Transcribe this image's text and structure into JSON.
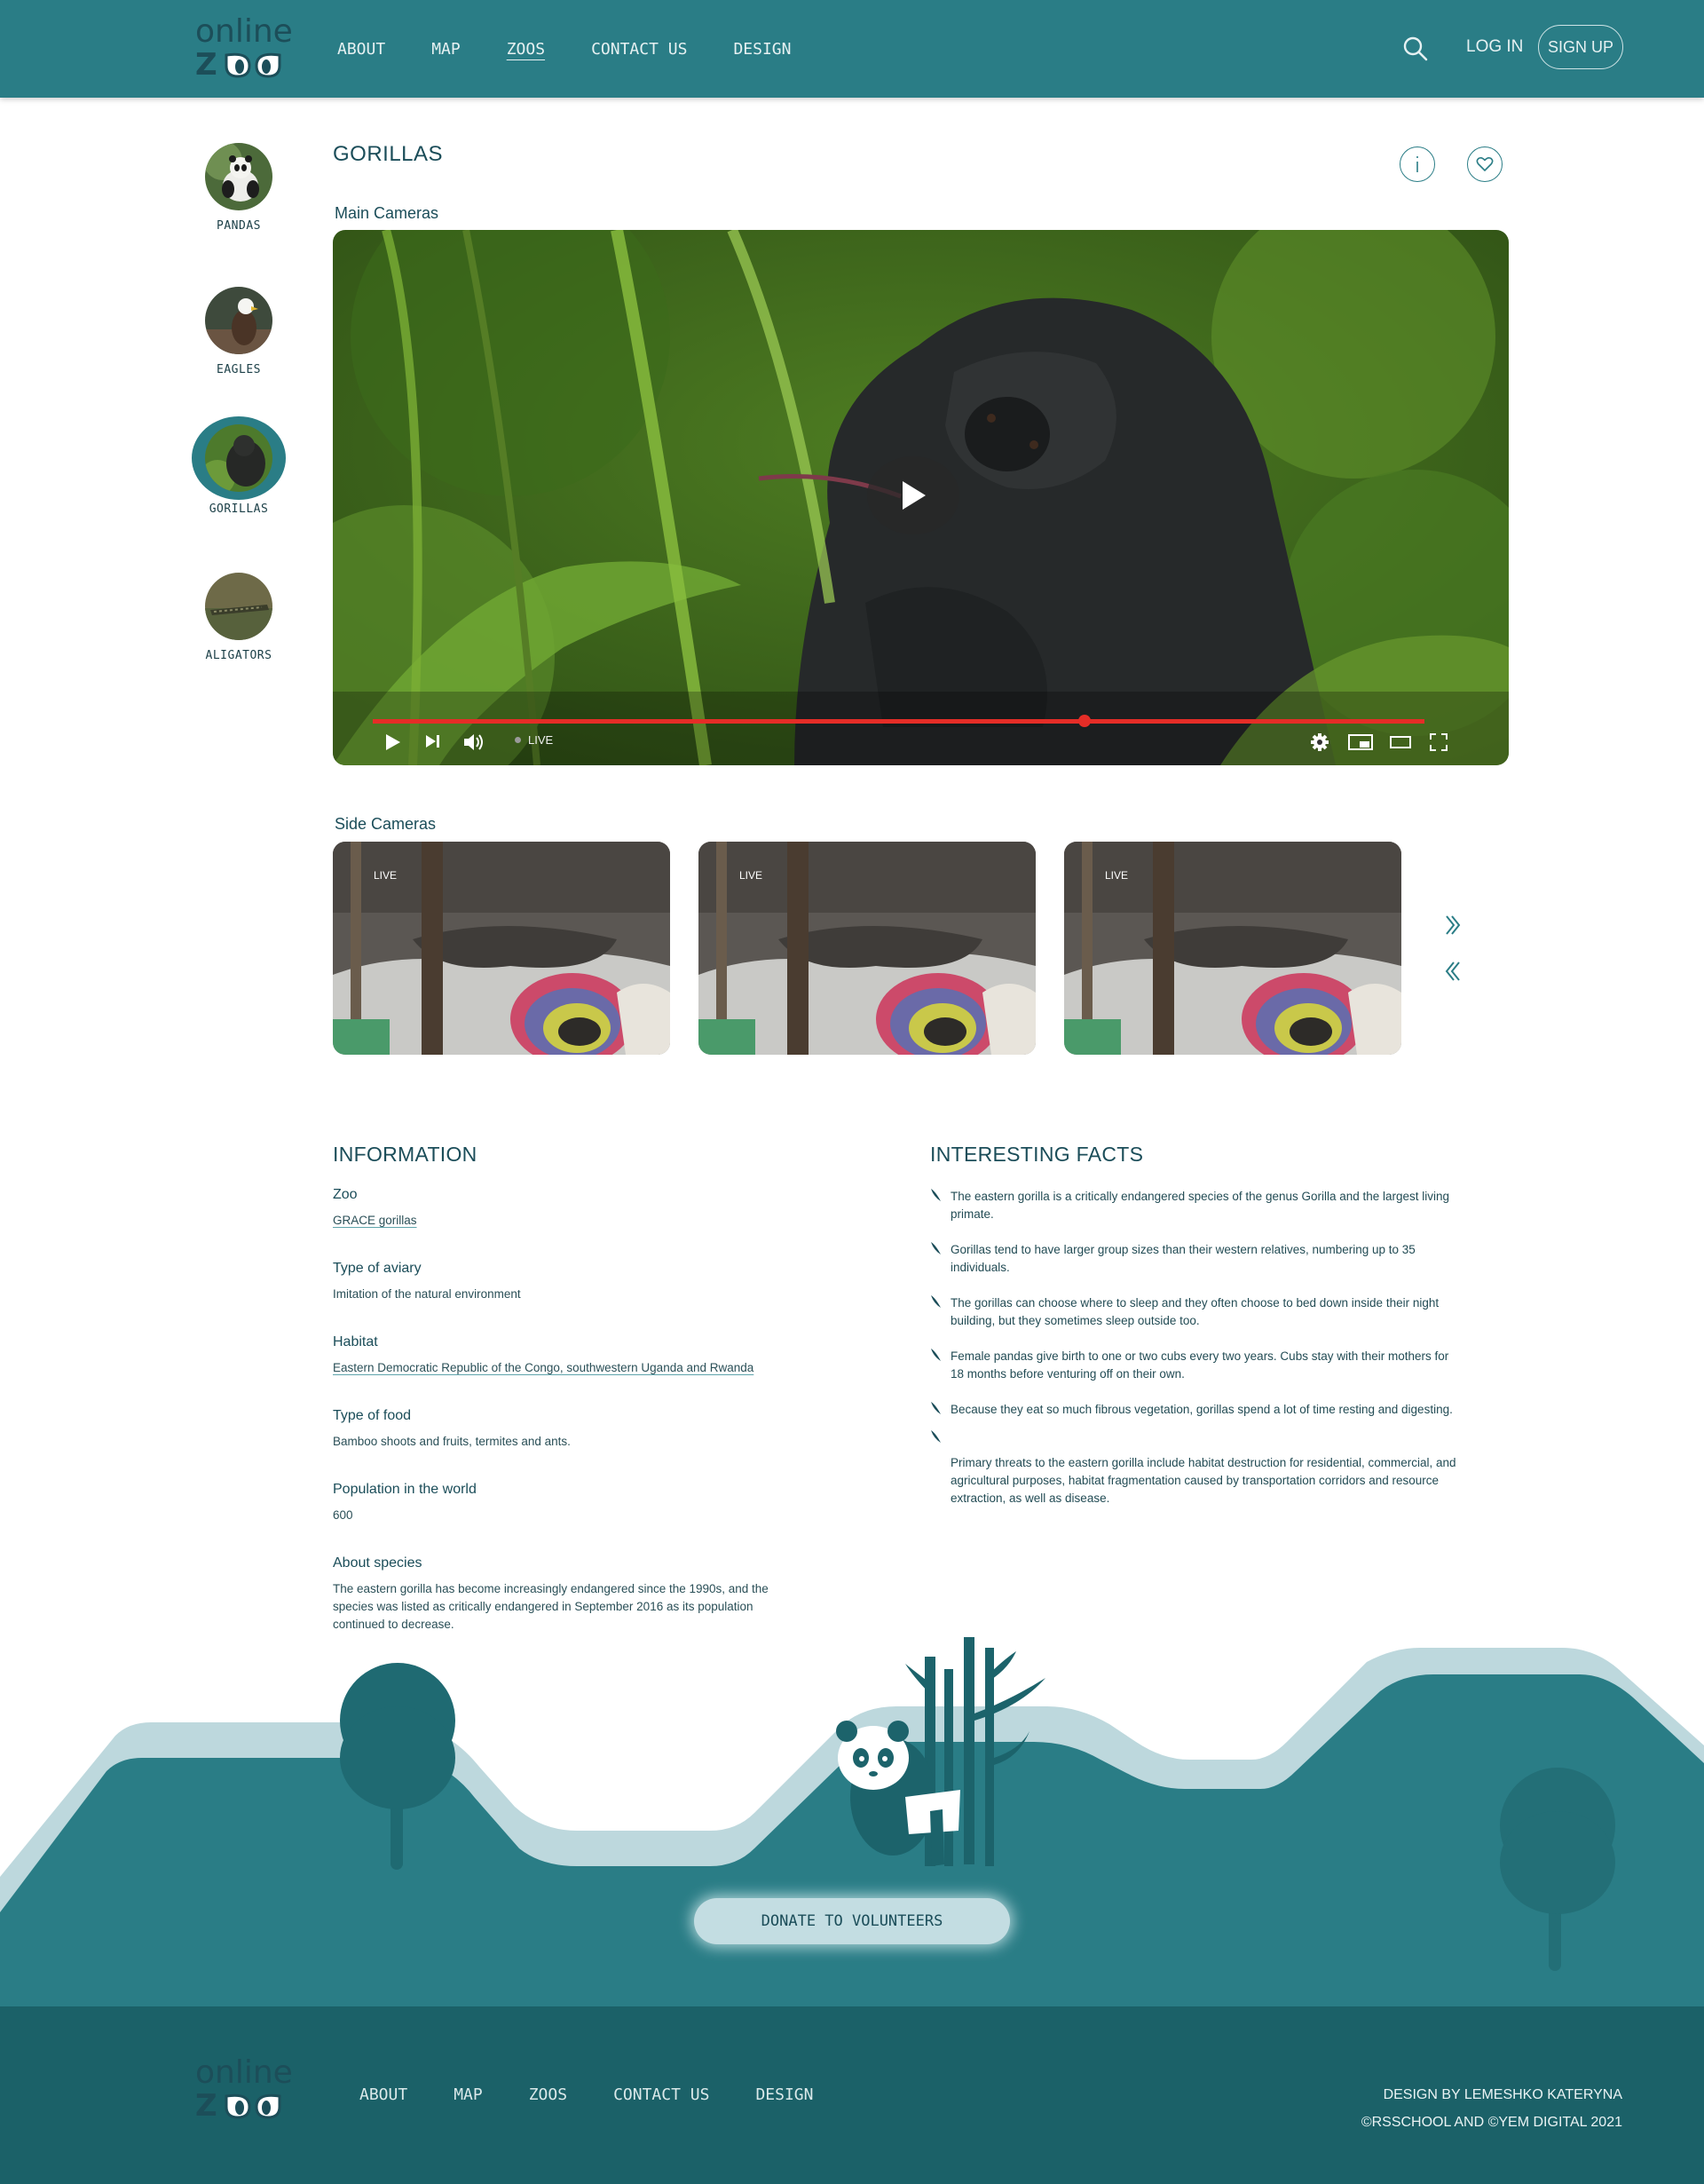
{
  "header": {
    "logo_line1": "online",
    "logo_line2": "Z",
    "nav": [
      {
        "label": "ABOUT"
      },
      {
        "label": "MAP"
      },
      {
        "label": "ZOOS",
        "active": true
      },
      {
        "label": "CONTACT US"
      },
      {
        "label": "DESIGN"
      }
    ],
    "search_icon": "search-icon",
    "login": "LOG IN",
    "signup": "SIGN UP"
  },
  "sidebar": {
    "animals": [
      {
        "label": "PANDAS"
      },
      {
        "label": "EAGLES"
      },
      {
        "label": "GORILLAS",
        "active": true
      },
      {
        "label": "ALIGATORS"
      }
    ]
  },
  "page": {
    "title": "GORILLAS",
    "info_icon": "info-icon",
    "favorite_icon": "heart-icon"
  },
  "main_camera": {
    "label": "Main Cameras",
    "live": "LIVE",
    "progress": 0.96
  },
  "side_cameras": {
    "label": "Side Cameras",
    "cams": [
      {
        "live": "LIVE"
      },
      {
        "live": "LIVE"
      },
      {
        "live": "LIVE"
      }
    ]
  },
  "information": {
    "title": "INFORMATION",
    "items": [
      {
        "label": "Zoo",
        "value": "GRACE gorillas"
      },
      {
        "label": "Type of aviary",
        "value": "Imitation of the natural environment"
      },
      {
        "label": "Habitat",
        "value": "Eastern Democratic Republic of the Congo, southwestern Uganda and Rwanda"
      },
      {
        "label": "Type of food",
        "value": "Bamboo shoots and fruits, termites and ants."
      },
      {
        "label": "Population in the world",
        "value": "600"
      },
      {
        "label": "About species",
        "value": "The eastern gorilla has become increasingly endangered since the 1990s, and the species was listed as critically endangered in September 2016 as its population continued to decrease."
      }
    ]
  },
  "facts": {
    "title": "INTERESTING FACTS",
    "items": [
      "The eastern gorilla is a critically endangered species of the genus Gorilla and the largest living primate.",
      "Gorillas tend to have larger group sizes than their western relatives, numbering up to 35 individuals.",
      "The gorillas can choose where to sleep and they often choose to bed down inside their night building, but they sometimes sleep outside too.",
      "Female pandas give birth to one or two cubs every two years. Cubs stay with their mothers for 18 months before venturing off on their own.",
      "Because they eat so much fibrous vegetation, gorillas spend a lot of time resting and digesting.",
      "Primary threats to the eastern gorilla include habitat destruction for residential, commercial, and agricultural purposes, habitat fragmentation caused by transportation corridors and resource extraction, as well as disease."
    ]
  },
  "donate": {
    "label": "DONATE TO VOLUNTEERS"
  },
  "footer": {
    "logo_line1": "online",
    "logo_line2": "Z",
    "nav": [
      "ABOUT",
      "MAP",
      "ZOOS",
      "CONTACT US",
      "DESIGN"
    ],
    "credit1": "DESIGN BY LEMESHKO KATERYNA",
    "credit2": "©RSSCHOOL AND ©YEM DIGITAL 2021"
  },
  "colors": {
    "brand": "#2a7d86",
    "footer": "#1b6168",
    "hills_light": "#bdd8dd",
    "progress": "#e52d27"
  }
}
